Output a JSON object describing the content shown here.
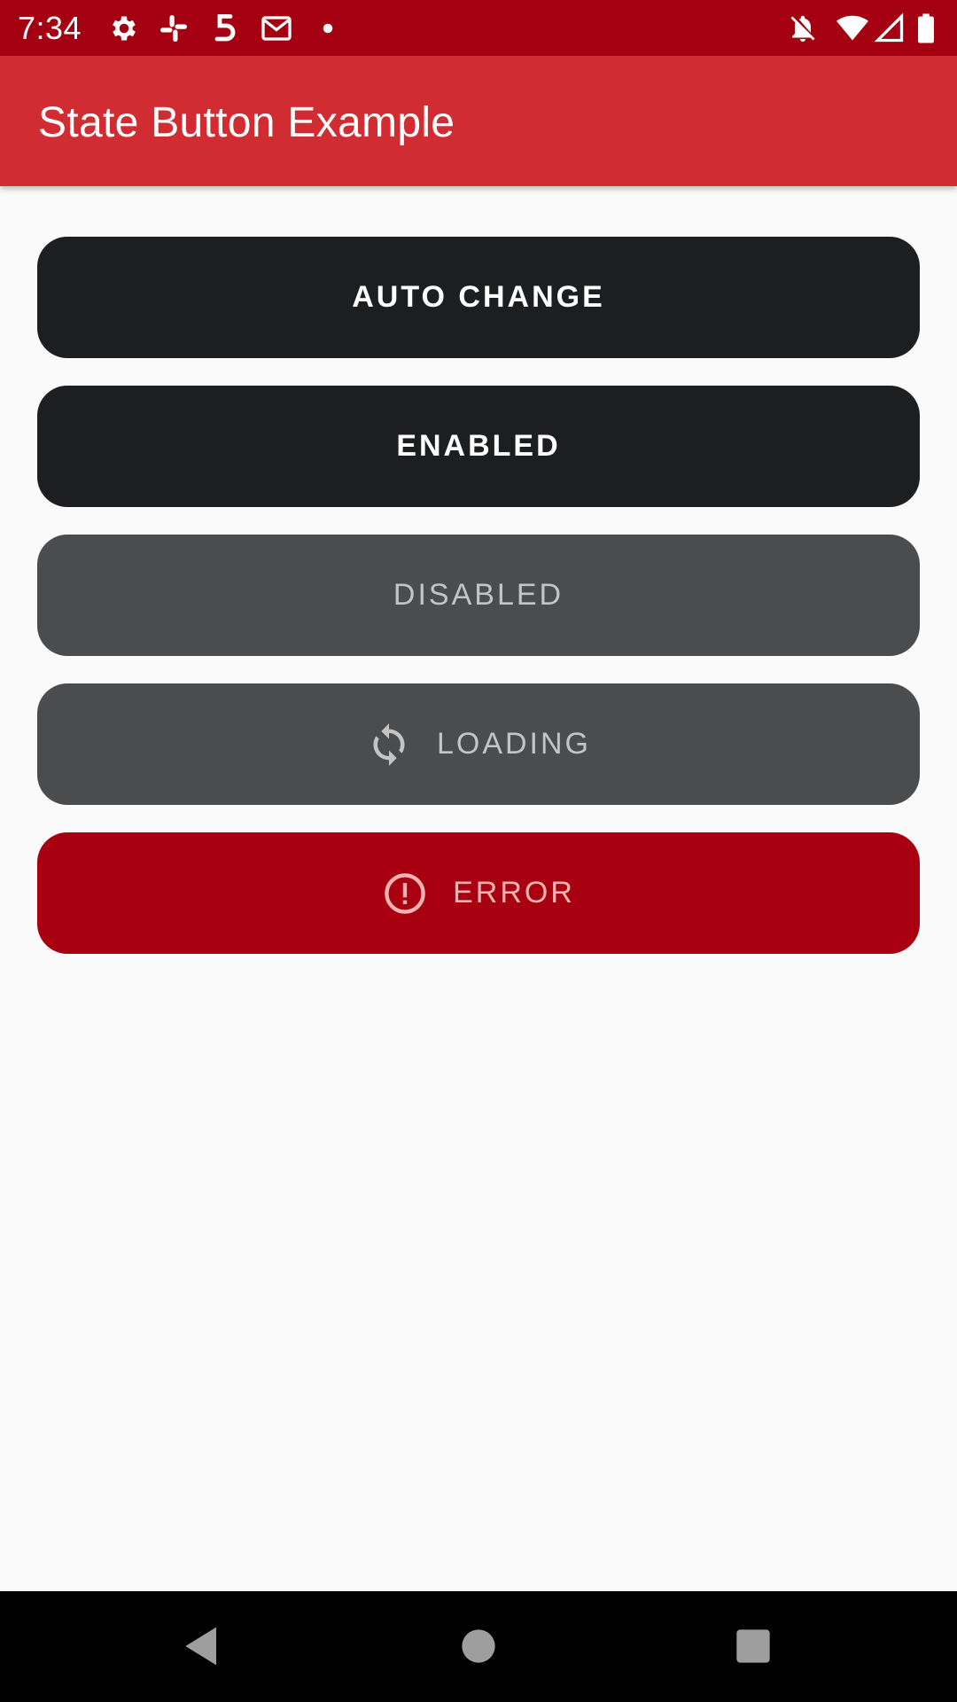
{
  "status_bar": {
    "time": "7:34",
    "left_icons": [
      "settings-icon",
      "slack-icon",
      "app-s-icon",
      "gmail-icon",
      "dot-icon"
    ],
    "right_icons": [
      "notifications-off-icon",
      "wifi-icon",
      "signal-icon",
      "battery-icon"
    ],
    "background": "#a50011"
  },
  "app_bar": {
    "title": "State Button Example",
    "background": "#d02c31"
  },
  "buttons": [
    {
      "label": "AUTO CHANGE",
      "state": "enabled",
      "color": "#1d1e20"
    },
    {
      "label": "ENABLED",
      "state": "enabled",
      "color": "#1d1e20"
    },
    {
      "label": "DISABLED",
      "state": "disabled",
      "color": "#4b4c4e"
    },
    {
      "label": "LOADING",
      "state": "loading",
      "icon": "refresh-icon",
      "color": "#4b4c4e"
    },
    {
      "label": "ERROR",
      "state": "error",
      "icon": "error-icon",
      "color": "#a80010"
    }
  ],
  "nav_bar": {
    "items": [
      "back-icon",
      "home-icon",
      "recents-icon"
    ]
  }
}
